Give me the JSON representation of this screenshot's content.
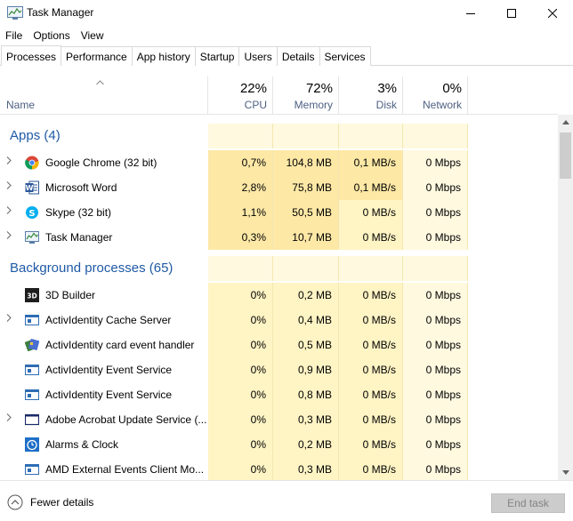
{
  "window": {
    "title": "Task Manager",
    "icon": "task-manager-icon"
  },
  "menu": {
    "file": "File",
    "options": "Options",
    "view": "View"
  },
  "tabs": [
    {
      "label": "Processes",
      "active": true
    },
    {
      "label": "Performance",
      "active": false
    },
    {
      "label": "App history",
      "active": false
    },
    {
      "label": "Startup",
      "active": false
    },
    {
      "label": "Users",
      "active": false
    },
    {
      "label": "Details",
      "active": false
    },
    {
      "label": "Services",
      "active": false
    }
  ],
  "columns": {
    "name": "Name",
    "cpu": {
      "percent": "22%",
      "label": "CPU"
    },
    "memory": {
      "percent": "72%",
      "label": "Memory"
    },
    "disk": {
      "percent": "3%",
      "label": "Disk"
    },
    "network": {
      "percent": "0%",
      "label": "Network"
    }
  },
  "groups": {
    "apps": "Apps (4)",
    "background": "Background processes (65)"
  },
  "apps": [
    {
      "name": "Google Chrome (32 bit)",
      "cpu": "0,7%",
      "memory": "104,8 MB",
      "disk": "0,1 MB/s",
      "network": "0 Mbps",
      "icon": "chrome-icon",
      "expandable": true
    },
    {
      "name": "Microsoft Word",
      "cpu": "2,8%",
      "memory": "75,8 MB",
      "disk": "0,1 MB/s",
      "network": "0 Mbps",
      "icon": "word-icon",
      "expandable": true
    },
    {
      "name": "Skype (32 bit)",
      "cpu": "1,1%",
      "memory": "50,5 MB",
      "disk": "0 MB/s",
      "network": "0 Mbps",
      "icon": "skype-icon",
      "expandable": true
    },
    {
      "name": "Task Manager",
      "cpu": "0,3%",
      "memory": "10,7 MB",
      "disk": "0 MB/s",
      "network": "0 Mbps",
      "icon": "task-manager-icon",
      "expandable": true
    }
  ],
  "background": [
    {
      "name": "3D Builder",
      "cpu": "0%",
      "memory": "0,2 MB",
      "disk": "0 MB/s",
      "network": "0 Mbps",
      "icon": "3d-builder-icon",
      "expandable": false
    },
    {
      "name": "ActivIdentity Cache Server",
      "cpu": "0%",
      "memory": "0,4 MB",
      "disk": "0 MB/s",
      "network": "0 Mbps",
      "icon": "service-icon",
      "expandable": true
    },
    {
      "name": "ActivIdentity card event handler",
      "cpu": "0%",
      "memory": "0,5 MB",
      "disk": "0 MB/s",
      "network": "0 Mbps",
      "icon": "card-handler-icon",
      "expandable": false
    },
    {
      "name": "ActivIdentity Event Service",
      "cpu": "0%",
      "memory": "0,9 MB",
      "disk": "0 MB/s",
      "network": "0 Mbps",
      "icon": "service-icon",
      "expandable": false
    },
    {
      "name": "ActivIdentity Event Service",
      "cpu": "0%",
      "memory": "0,8 MB",
      "disk": "0 MB/s",
      "network": "0 Mbps",
      "icon": "service-icon",
      "expandable": false
    },
    {
      "name": "Adobe Acrobat Update Service (...",
      "cpu": "0%",
      "memory": "0,3 MB",
      "disk": "0 MB/s",
      "network": "0 Mbps",
      "icon": "window-icon",
      "expandable": true
    },
    {
      "name": "Alarms & Clock",
      "cpu": "0%",
      "memory": "0,2 MB",
      "disk": "0 MB/s",
      "network": "0 Mbps",
      "icon": "alarm-clock-icon",
      "expandable": false
    },
    {
      "name": "AMD External Events Client Mo...",
      "cpu": "0%",
      "memory": "0,3 MB",
      "disk": "0 MB/s",
      "network": "0 Mbps",
      "icon": "service-icon",
      "expandable": false
    }
  ],
  "footer": {
    "fewer_details": "Fewer details",
    "end_task": "End task"
  },
  "colors": {
    "heat_light": "#fff9e0",
    "heat_medium": "#fff4c4",
    "heat_dark": "#fde8a6",
    "group_title": "#1f5aa6",
    "column_label": "#4d6082"
  }
}
